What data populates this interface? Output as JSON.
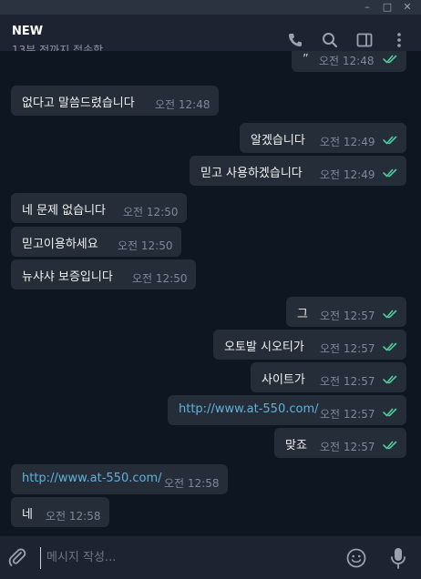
{
  "header": {
    "title": "NEW",
    "status": "13분 전까지 접속함"
  },
  "messages": [
    {
      "dir": "out",
      "text": "",
      "time": "오전 12:48",
      "link": false
    },
    {
      "dir": "in",
      "text": "없다고 말씀드렸습니다",
      "time": "오전 12:48",
      "link": false
    },
    {
      "dir": "out",
      "text": "알겠습니다",
      "time": "오전 12:49",
      "link": false
    },
    {
      "dir": "out",
      "text": "믿고 사용하겠습니다",
      "time": "오전 12:49",
      "link": false
    },
    {
      "dir": "in",
      "text": "네 문제 없습니다",
      "time": "오전 12:50",
      "link": false
    },
    {
      "dir": "in",
      "text": "믿고이용하세요",
      "time": "오전 12:50",
      "link": false
    },
    {
      "dir": "in",
      "text": "뉴샤샤 보증입니다",
      "time": "오전 12:50",
      "link": false
    },
    {
      "dir": "out",
      "text": "그",
      "time": "오전 12:57",
      "link": false
    },
    {
      "dir": "out",
      "text": "오토발 시오티가",
      "time": "오전 12:57",
      "link": false
    },
    {
      "dir": "out",
      "text": "사이트가",
      "time": "오전 12:57",
      "link": false
    },
    {
      "dir": "out",
      "text": "http://www.at-550.com/",
      "time": "오전 12:57",
      "link": true
    },
    {
      "dir": "out",
      "text": "맞죠",
      "time": "오전 12:57",
      "link": false
    },
    {
      "dir": "in",
      "text": "http://www.at-550.com/",
      "time": "오전 12:58",
      "link": true
    },
    {
      "dir": "in",
      "text": "네",
      "time": "오전 12:58",
      "link": false
    }
  ],
  "composer": {
    "placeholder": "메시지 작성..."
  },
  "colors": {
    "accent": "#5fb2de",
    "read_check": "#4dcd9e",
    "bubble": "#252d38",
    "background": "#0e1621"
  },
  "icons": [
    "minimize-icon",
    "maximize-icon",
    "close-icon",
    "phone-icon",
    "search-icon",
    "sidebar-icon",
    "more-icon",
    "attach-icon",
    "emoji-icon",
    "microphone-icon"
  ]
}
